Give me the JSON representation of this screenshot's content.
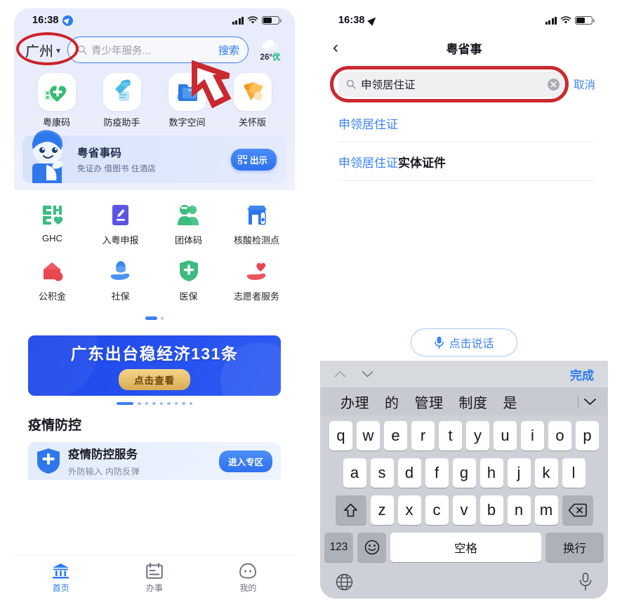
{
  "meta": {
    "accent_blue": "#2b7bf3",
    "annotation_red": "#c92a30",
    "link_blue": "#3b82f6"
  },
  "left_phone": {
    "status_bar": {
      "time": "16:38",
      "location_icon": "location-arrow-icon",
      "signal_icon": "cellular-bars-icon",
      "wifi_icon": "wifi-icon",
      "battery_icon": "battery-icon"
    },
    "header": {
      "city": "广州",
      "city_chevron": "chevron-down-icon",
      "search_icon": "search-icon",
      "search_placeholder": "青少年服务...",
      "search_button": "搜索",
      "weather_icon": "cloud-icon",
      "weather_temp": "26°",
      "weather_quality": "优"
    },
    "quick_icons": [
      {
        "label": "粤康码",
        "icon": "green-heart-qr-icon"
      },
      {
        "label": "防疫助手",
        "icon": "blue-spray-icon"
      },
      {
        "label": "数字空间",
        "icon": "blue-folder-icon"
      },
      {
        "label": "关怀版",
        "icon": "orange-ribbon-icon"
      }
    ],
    "mascot_card": {
      "mascot_icon": "blue-mascot-icon",
      "title": "粤省事码",
      "subtitle": "免证办 借图书 住酒店",
      "button_icon": "qr-code-icon",
      "button_label": "出示"
    },
    "service_grid": [
      {
        "label": "GHC",
        "icon": "ghc-logo-icon"
      },
      {
        "label": "入粤申报",
        "icon": "purple-pencil-form-icon"
      },
      {
        "label": "团体码",
        "icon": "green-group-people-icon"
      },
      {
        "label": "核酸检测点",
        "icon": "blue-test-booth-icon"
      },
      {
        "label": "公积金",
        "icon": "red-house-coin-icon"
      },
      {
        "label": "社保",
        "icon": "blue-hand-person-icon"
      },
      {
        "label": "医保",
        "icon": "green-shield-cross-icon"
      },
      {
        "label": "志愿者服务",
        "icon": "red-heart-hand-icon"
      }
    ],
    "grid_pager": {
      "active_index": 0,
      "total": 2
    },
    "banner": {
      "title": "广东出台稳经济131条",
      "button": "点击查看"
    },
    "banner_pager": {
      "active_index": 0,
      "total": 9
    },
    "section": {
      "title": "疫情防控",
      "card": {
        "icon": "blue-shield-cross-icon",
        "title": "疫情防控服务",
        "subtitle": "外防输入 内防反弹",
        "button": "进入专区"
      }
    },
    "tabbar": [
      {
        "label": "首页",
        "icon": "home-bank-icon",
        "active": true
      },
      {
        "label": "办事",
        "icon": "calendar-tasks-icon",
        "active": false
      },
      {
        "label": "我的",
        "icon": "profile-face-icon",
        "active": false
      }
    ]
  },
  "right_phone": {
    "status_bar": {
      "time": "16:38",
      "location_icon": "location-arrow-icon",
      "signal_icon": "cellular-bars-icon",
      "wifi_icon": "wifi-icon",
      "battery_icon": "battery-icon"
    },
    "navbar": {
      "back_icon": "chevron-left-icon",
      "title": "粤省事"
    },
    "search": {
      "search_icon": "search-icon",
      "value": "申领居住证",
      "clear_icon": "clear-circle-icon",
      "cancel_label": "取消"
    },
    "suggestions": [
      {
        "match": "申领居住证",
        "rest": ""
      },
      {
        "match": "申领居住证",
        "rest": "实体证件"
      }
    ],
    "voice_button": {
      "icon": "microphone-icon",
      "label": "点击说话"
    },
    "keyboard": {
      "toolbar": {
        "up_icon": "chevron-up-icon",
        "down_icon": "chevron-down-icon",
        "done_label": "完成"
      },
      "candidates": [
        "办理",
        "的",
        "管理",
        "制度",
        "是"
      ],
      "candidates_expand_icon": "chevron-down-icon",
      "row1": [
        "q",
        "w",
        "e",
        "r",
        "t",
        "y",
        "u",
        "i",
        "o",
        "p"
      ],
      "row2": [
        "a",
        "s",
        "d",
        "f",
        "g",
        "h",
        "j",
        "k",
        "l"
      ],
      "row3": [
        "z",
        "x",
        "c",
        "v",
        "b",
        "n",
        "m"
      ],
      "shift_icon": "shift-up-arrow-icon",
      "delete_icon": "backspace-delete-icon",
      "numbers_key": "123",
      "emoji_key": "emoji-smiley-icon",
      "space_key": "空格",
      "enter_key": "换行",
      "globe_icon": "globe-language-icon",
      "dictation_icon": "microphone-icon"
    }
  },
  "annotations": {
    "city_highlight": "red-ellipse-highlight",
    "search_field_highlight": "red-ellipse-highlight",
    "cursor": "red-arrow-cursor"
  }
}
